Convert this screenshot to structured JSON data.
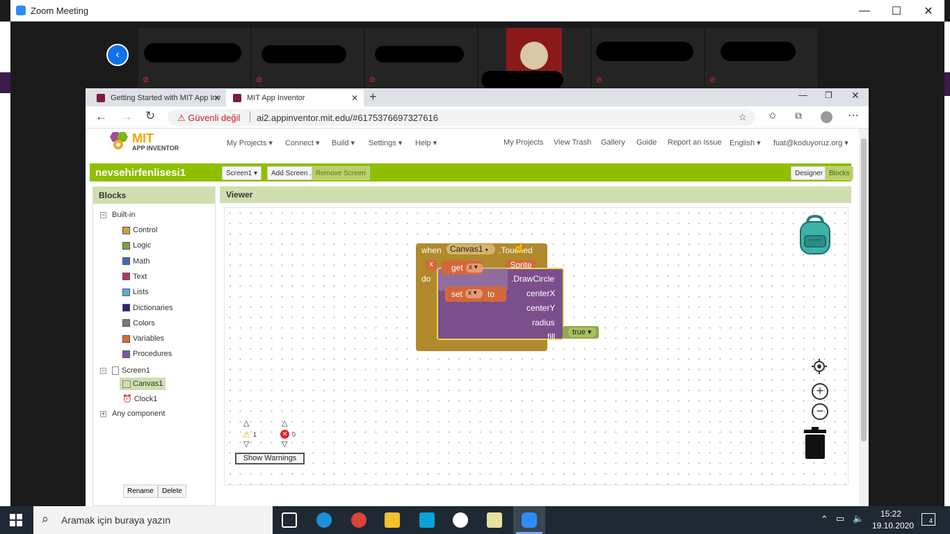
{
  "zoom": {
    "title": "Zoom Meeting"
  },
  "browser": {
    "tabs": [
      {
        "label": "Getting Started with MIT App Inv"
      },
      {
        "label": "MIT App Inventor"
      }
    ],
    "insecure_label": "Güvenli değil",
    "url": "ai2.appinventor.mit.edu/#6175376697327616"
  },
  "appinventor": {
    "logo_title": "MIT",
    "logo_sub": "APP INVENTOR",
    "menu_left": [
      "My Projects ▾",
      "Connect ▾",
      "Build ▾",
      "Settings ▾",
      "Help ▾"
    ],
    "menu_right": [
      "My Projects",
      "View Trash",
      "Gallery",
      "Guide",
      "Report an Issue",
      "English ▾",
      "fuat@koduyoruz.org ▾"
    ],
    "project_name": "nevsehirfenlisesi1",
    "screen_select": "Screen1 ▾",
    "add_screen": "Add Screen ...",
    "remove_screen": "Remove Screen",
    "designer": "Designer",
    "blocks_btn": "Blocks",
    "blocks_header": "Blocks",
    "viewer_header": "Viewer",
    "tree": {
      "builtin": "Built-in",
      "categories": [
        {
          "label": "Control",
          "color": "#c8a23c"
        },
        {
          "label": "Logic",
          "color": "#7fa23a"
        },
        {
          "label": "Math",
          "color": "#3c6fb0"
        },
        {
          "label": "Text",
          "color": "#b5365a"
        },
        {
          "label": "Lists",
          "color": "#5aaed8"
        },
        {
          "label": "Dictionaries",
          "color": "#2c1f8a"
        },
        {
          "label": "Colors",
          "color": "#7a7a7a"
        },
        {
          "label": "Variables",
          "color": "#e26b2e"
        },
        {
          "label": "Procedures",
          "color": "#7a5a9a"
        }
      ],
      "screen": "Screen1",
      "canvas": "Canvas1",
      "clock": "Clock1",
      "any": "Any component"
    },
    "rename": "Rename",
    "delete": "Delete",
    "blocks": {
      "when": "when",
      "canvas_event": "Canvas1",
      "touched": ".Touched",
      "x": "x",
      "sprite": "Sprite",
      "do": "do",
      "get": "get",
      "get_var": "x",
      "set": "set",
      "set_var": "x",
      "to": "to",
      "draw_circle": ".DrawCircle",
      "centerx": "centerX",
      "centery": "centerY",
      "radius": "radius",
      "fill": "fill",
      "true": "true ▾"
    },
    "warnings": {
      "count": "1",
      "errors": "0",
      "show": "Show Warnings"
    }
  },
  "taskbar": {
    "search": "Aramak için buraya yazın",
    "time": "15:22",
    "date": "19.10.2020",
    "notif": "4"
  }
}
